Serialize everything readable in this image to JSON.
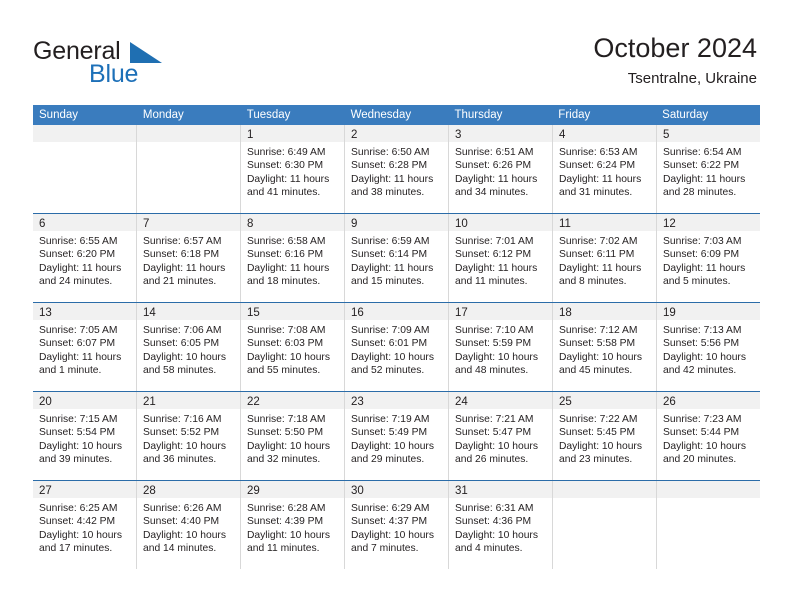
{
  "brand": {
    "name_part1": "General",
    "name_part2": "Blue",
    "accent_color": "#1d70b8",
    "triangle_icon": "triangle-icon"
  },
  "header": {
    "month_title": "October 2024",
    "location": "Tsentralne, Ukraine"
  },
  "theme": {
    "header_row_bg": "#3a7cbe",
    "day_band_bg": "#f1f1f1",
    "week_rule": "#2b6ca8",
    "cell_border": "#d8d8d8",
    "text": "#231f20"
  },
  "weekday_headers": [
    "Sunday",
    "Monday",
    "Tuesday",
    "Wednesday",
    "Thursday",
    "Friday",
    "Saturday"
  ],
  "weeks": [
    [
      {
        "day": "",
        "lines": []
      },
      {
        "day": "",
        "lines": []
      },
      {
        "day": "1",
        "lines": [
          "Sunrise: 6:49 AM",
          "Sunset: 6:30 PM",
          "Daylight: 11 hours",
          "and 41 minutes."
        ]
      },
      {
        "day": "2",
        "lines": [
          "Sunrise: 6:50 AM",
          "Sunset: 6:28 PM",
          "Daylight: 11 hours",
          "and 38 minutes."
        ]
      },
      {
        "day": "3",
        "lines": [
          "Sunrise: 6:51 AM",
          "Sunset: 6:26 PM",
          "Daylight: 11 hours",
          "and 34 minutes."
        ]
      },
      {
        "day": "4",
        "lines": [
          "Sunrise: 6:53 AM",
          "Sunset: 6:24 PM",
          "Daylight: 11 hours",
          "and 31 minutes."
        ]
      },
      {
        "day": "5",
        "lines": [
          "Sunrise: 6:54 AM",
          "Sunset: 6:22 PM",
          "Daylight: 11 hours",
          "and 28 minutes."
        ]
      }
    ],
    [
      {
        "day": "6",
        "lines": [
          "Sunrise: 6:55 AM",
          "Sunset: 6:20 PM",
          "Daylight: 11 hours",
          "and 24 minutes."
        ]
      },
      {
        "day": "7",
        "lines": [
          "Sunrise: 6:57 AM",
          "Sunset: 6:18 PM",
          "Daylight: 11 hours",
          "and 21 minutes."
        ]
      },
      {
        "day": "8",
        "lines": [
          "Sunrise: 6:58 AM",
          "Sunset: 6:16 PM",
          "Daylight: 11 hours",
          "and 18 minutes."
        ]
      },
      {
        "day": "9",
        "lines": [
          "Sunrise: 6:59 AM",
          "Sunset: 6:14 PM",
          "Daylight: 11 hours",
          "and 15 minutes."
        ]
      },
      {
        "day": "10",
        "lines": [
          "Sunrise: 7:01 AM",
          "Sunset: 6:12 PM",
          "Daylight: 11 hours",
          "and 11 minutes."
        ]
      },
      {
        "day": "11",
        "lines": [
          "Sunrise: 7:02 AM",
          "Sunset: 6:11 PM",
          "Daylight: 11 hours",
          "and 8 minutes."
        ]
      },
      {
        "day": "12",
        "lines": [
          "Sunrise: 7:03 AM",
          "Sunset: 6:09 PM",
          "Daylight: 11 hours",
          "and 5 minutes."
        ]
      }
    ],
    [
      {
        "day": "13",
        "lines": [
          "Sunrise: 7:05 AM",
          "Sunset: 6:07 PM",
          "Daylight: 11 hours",
          "and 1 minute."
        ]
      },
      {
        "day": "14",
        "lines": [
          "Sunrise: 7:06 AM",
          "Sunset: 6:05 PM",
          "Daylight: 10 hours",
          "and 58 minutes."
        ]
      },
      {
        "day": "15",
        "lines": [
          "Sunrise: 7:08 AM",
          "Sunset: 6:03 PM",
          "Daylight: 10 hours",
          "and 55 minutes."
        ]
      },
      {
        "day": "16",
        "lines": [
          "Sunrise: 7:09 AM",
          "Sunset: 6:01 PM",
          "Daylight: 10 hours",
          "and 52 minutes."
        ]
      },
      {
        "day": "17",
        "lines": [
          "Sunrise: 7:10 AM",
          "Sunset: 5:59 PM",
          "Daylight: 10 hours",
          "and 48 minutes."
        ]
      },
      {
        "day": "18",
        "lines": [
          "Sunrise: 7:12 AM",
          "Sunset: 5:58 PM",
          "Daylight: 10 hours",
          "and 45 minutes."
        ]
      },
      {
        "day": "19",
        "lines": [
          "Sunrise: 7:13 AM",
          "Sunset: 5:56 PM",
          "Daylight: 10 hours",
          "and 42 minutes."
        ]
      }
    ],
    [
      {
        "day": "20",
        "lines": [
          "Sunrise: 7:15 AM",
          "Sunset: 5:54 PM",
          "Daylight: 10 hours",
          "and 39 minutes."
        ]
      },
      {
        "day": "21",
        "lines": [
          "Sunrise: 7:16 AM",
          "Sunset: 5:52 PM",
          "Daylight: 10 hours",
          "and 36 minutes."
        ]
      },
      {
        "day": "22",
        "lines": [
          "Sunrise: 7:18 AM",
          "Sunset: 5:50 PM",
          "Daylight: 10 hours",
          "and 32 minutes."
        ]
      },
      {
        "day": "23",
        "lines": [
          "Sunrise: 7:19 AM",
          "Sunset: 5:49 PM",
          "Daylight: 10 hours",
          "and 29 minutes."
        ]
      },
      {
        "day": "24",
        "lines": [
          "Sunrise: 7:21 AM",
          "Sunset: 5:47 PM",
          "Daylight: 10 hours",
          "and 26 minutes."
        ]
      },
      {
        "day": "25",
        "lines": [
          "Sunrise: 7:22 AM",
          "Sunset: 5:45 PM",
          "Daylight: 10 hours",
          "and 23 minutes."
        ]
      },
      {
        "day": "26",
        "lines": [
          "Sunrise: 7:23 AM",
          "Sunset: 5:44 PM",
          "Daylight: 10 hours",
          "and 20 minutes."
        ]
      }
    ],
    [
      {
        "day": "27",
        "lines": [
          "Sunrise: 6:25 AM",
          "Sunset: 4:42 PM",
          "Daylight: 10 hours",
          "and 17 minutes."
        ]
      },
      {
        "day": "28",
        "lines": [
          "Sunrise: 6:26 AM",
          "Sunset: 4:40 PM",
          "Daylight: 10 hours",
          "and 14 minutes."
        ]
      },
      {
        "day": "29",
        "lines": [
          "Sunrise: 6:28 AM",
          "Sunset: 4:39 PM",
          "Daylight: 10 hours",
          "and 11 minutes."
        ]
      },
      {
        "day": "30",
        "lines": [
          "Sunrise: 6:29 AM",
          "Sunset: 4:37 PM",
          "Daylight: 10 hours",
          "and 7 minutes."
        ]
      },
      {
        "day": "31",
        "lines": [
          "Sunrise: 6:31 AM",
          "Sunset: 4:36 PM",
          "Daylight: 10 hours",
          "and 4 minutes."
        ]
      },
      {
        "day": "",
        "lines": []
      },
      {
        "day": "",
        "lines": []
      }
    ]
  ]
}
